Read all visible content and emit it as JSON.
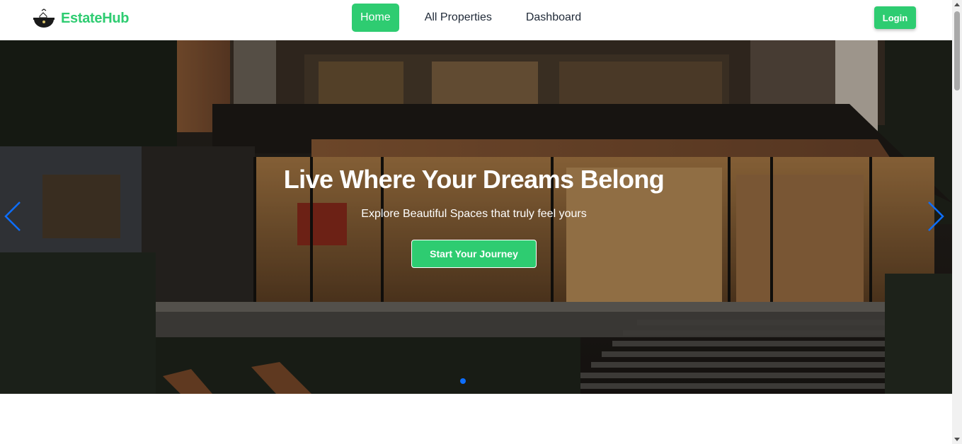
{
  "brand": {
    "name": "EstateHub",
    "logo_icon": "house-logo-icon"
  },
  "nav": {
    "items": [
      {
        "label": "Home",
        "active": true
      },
      {
        "label": "All Properties",
        "active": false
      },
      {
        "label": "Dashboard",
        "active": false
      }
    ],
    "login_label": "Login"
  },
  "hero": {
    "title": "Live Where Your Dreams Belong",
    "subtitle": "Explore Beautiful Spaces that truly feel yours",
    "cta_label": "Start Your Journey",
    "prev_icon": "chevron-left-icon",
    "next_icon": "chevron-right-icon",
    "slides_count": 1,
    "active_slide": 1
  },
  "colors": {
    "accent": "#2ecc71",
    "dot_active": "#0d6efd",
    "arrow": "#0d6efd",
    "text_dark": "#1f2937"
  }
}
